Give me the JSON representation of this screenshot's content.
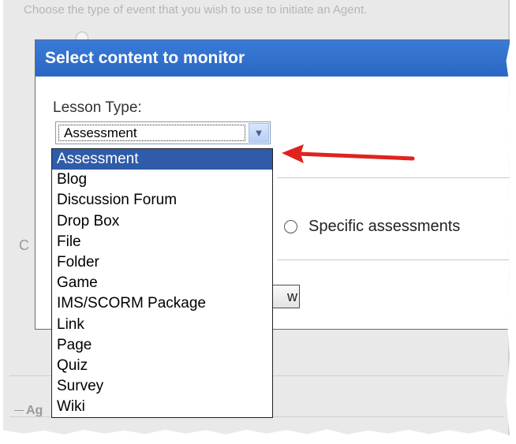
{
  "background": {
    "hint_text": "Choose the type of event that you wish to use to initiate an Agent.",
    "partial_c": "C",
    "partial_ag": "Ag"
  },
  "dialog": {
    "title": "Select content to monitor",
    "field_label": "Lesson Type:",
    "selected_value": "Assessment",
    "radio_label": "Specific assessments",
    "partial_button_text": "w"
  },
  "dropdown": {
    "options": [
      "Assessment",
      "Blog",
      "Discussion Forum",
      "Drop Box",
      "File",
      "Folder",
      "Game",
      "IMS/SCORM Package",
      "Link",
      "Page",
      "Quiz",
      "Survey",
      "Wiki"
    ],
    "selected_index": 0
  },
  "colors": {
    "title_bar": "#2f71d0",
    "selection": "#2f5ba8",
    "arrow": "#e0231d"
  }
}
